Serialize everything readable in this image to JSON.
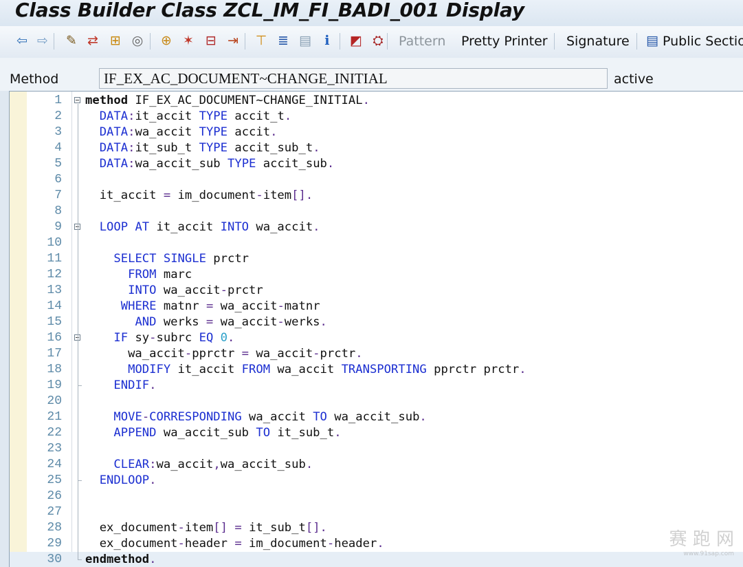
{
  "window": {
    "title": "Class Builder Class ZCL_IM_FI_BADI_001 Display"
  },
  "toolbar": {
    "icons": [
      {
        "name": "back-icon",
        "glyph": "⇦",
        "color": "#2f6fb6"
      },
      {
        "name": "forward-icon",
        "glyph": "⇨",
        "color": "#7aa1c8"
      },
      {
        "name": "display-change-icon",
        "glyph": "✎",
        "color": "#7a5a1e"
      },
      {
        "name": "active-inactive-icon",
        "glyph": "⇄",
        "color": "#c0392b"
      },
      {
        "name": "check-icon",
        "glyph": "⊞",
        "color": "#c98a12"
      },
      {
        "name": "activate-icon",
        "glyph": "◎",
        "color": "#666666"
      },
      {
        "name": "object-list-icon",
        "glyph": "⊕",
        "color": "#c88b1c"
      },
      {
        "name": "wand-icon",
        "glyph": "✶",
        "color": "#c0392b"
      },
      {
        "name": "where-used-icon",
        "glyph": "⊟",
        "color": "#b02a2a"
      },
      {
        "name": "navigation-icon",
        "glyph": "⇥",
        "color": "#b9461f"
      },
      {
        "name": "hierarchy-icon",
        "glyph": "⊤",
        "color": "#d08a12"
      },
      {
        "name": "stack-icon",
        "glyph": "≣",
        "color": "#2456a8"
      },
      {
        "name": "table-icon",
        "glyph": "▤",
        "color": "#8aa0b4"
      },
      {
        "name": "info-icon",
        "glyph": "ℹ",
        "color": "#1f5fbf"
      },
      {
        "name": "module-icon",
        "glyph": "◩",
        "color": "#b52525"
      },
      {
        "name": "debug-icon",
        "glyph": "⛭",
        "color": "#a52121"
      }
    ],
    "pattern_label": "Pattern",
    "pretty_printer_label": "Pretty Printer",
    "signature_label": "Signature",
    "public_section_label": "Public Section"
  },
  "method_bar": {
    "label": "Method",
    "value": "IF_EX_AC_DOCUMENT~CHANGE_INITIAL",
    "status": "active"
  },
  "editor": {
    "lines": [
      {
        "n": "1",
        "html": "<span class=\"kwb\">method</span> IF_EX_AC_DOCUMENT~CHANGE_INITIAL<span class=\"pn\">.</span>"
      },
      {
        "n": "2",
        "html": "  <span class=\"kw\">DATA</span><span class=\"pn\">:</span>it_accit <span class=\"kw\">TYPE</span> accit_t<span class=\"pn\">.</span>"
      },
      {
        "n": "3",
        "html": "  <span class=\"kw\">DATA</span><span class=\"pn\">:</span>wa_accit <span class=\"kw\">TYPE</span> accit<span class=\"pn\">.</span>"
      },
      {
        "n": "4",
        "html": "  <span class=\"kw\">DATA</span><span class=\"pn\">:</span>it_sub_t <span class=\"kw\">TYPE</span> accit_sub_t<span class=\"pn\">.</span>"
      },
      {
        "n": "5",
        "html": "  <span class=\"kw\">DATA</span><span class=\"pn\">:</span>wa_accit_sub <span class=\"kw\">TYPE</span> accit_sub<span class=\"pn\">.</span>"
      },
      {
        "n": "6",
        "html": ""
      },
      {
        "n": "7",
        "html": "  it_accit <span class=\"pn\">=</span> im_document<span class=\"pn\">-</span>item<span class=\"pn\">[].</span>"
      },
      {
        "n": "8",
        "html": ""
      },
      {
        "n": "9",
        "html": "  <span class=\"kw\">LOOP AT</span> it_accit <span class=\"kw\">INTO</span> wa_accit<span class=\"pn\">.</span>"
      },
      {
        "n": "10",
        "html": ""
      },
      {
        "n": "11",
        "html": "    <span class=\"kw\">SELECT SINGLE</span> prctr"
      },
      {
        "n": "12",
        "html": "      <span class=\"kw\">FROM</span> marc"
      },
      {
        "n": "13",
        "html": "      <span class=\"kw\">INTO</span> wa_accit<span class=\"pn\">-</span>prctr"
      },
      {
        "n": "14",
        "html": "     <span class=\"kw\">WHERE</span> matnr <span class=\"pn\">=</span> wa_accit<span class=\"pn\">-</span>matnr"
      },
      {
        "n": "15",
        "html": "       <span class=\"kw\">AND</span> werks <span class=\"pn\">=</span> wa_accit<span class=\"pn\">-</span>werks<span class=\"pn\">.</span>"
      },
      {
        "n": "16",
        "html": "    <span class=\"kw\">IF</span> sy<span class=\"pn\">-</span>subrc <span class=\"kw\">EQ</span> <span class=\"nm\">0</span><span class=\"pn\">.</span>"
      },
      {
        "n": "17",
        "html": "      wa_accit<span class=\"pn\">-</span>pprctr <span class=\"pn\">=</span> wa_accit<span class=\"pn\">-</span>prctr<span class=\"pn\">.</span>"
      },
      {
        "n": "18",
        "html": "      <span class=\"kw\">MODIFY</span> it_accit <span class=\"kw\">FROM</span> wa_accit <span class=\"kw\">TRANSPORTING</span> pprctr prctr<span class=\"pn\">.</span>"
      },
      {
        "n": "19",
        "html": "    <span class=\"kw\">ENDIF</span><span class=\"pn\">.</span>"
      },
      {
        "n": "20",
        "html": ""
      },
      {
        "n": "21",
        "html": "    <span class=\"kw\">MOVE</span><span class=\"pn\">-</span><span class=\"kw\">CORRESPONDING</span> wa_accit <span class=\"kw\">TO</span> wa_accit_sub<span class=\"pn\">.</span>"
      },
      {
        "n": "22",
        "html": "    <span class=\"kw\">APPEND</span> wa_accit_sub <span class=\"kw\">TO</span> it_sub_t<span class=\"pn\">.</span>"
      },
      {
        "n": "23",
        "html": ""
      },
      {
        "n": "24",
        "html": "    <span class=\"kw\">CLEAR</span><span class=\"pn\">:</span>wa_accit<span class=\"pn\">,</span>wa_accit_sub<span class=\"pn\">.</span>"
      },
      {
        "n": "25",
        "html": "  <span class=\"kw\">ENDLOOP</span><span class=\"pn\">.</span>"
      },
      {
        "n": "26",
        "html": ""
      },
      {
        "n": "27",
        "html": ""
      },
      {
        "n": "28",
        "html": "  ex_document<span class=\"pn\">-</span>item<span class=\"pn\">[]</span> <span class=\"pn\">=</span> it_sub_t<span class=\"pn\">[].</span>"
      },
      {
        "n": "29",
        "html": "  ex_document<span class=\"pn\">-</span>header <span class=\"pn\">=</span> im_document<span class=\"pn\">-</span>header<span class=\"pn\">.</span>"
      },
      {
        "n": "30",
        "html": "<span class=\"kwb\">endmethod</span><span class=\"pn\">.</span>"
      }
    ],
    "fold_lines": [
      "1",
      "9",
      "16"
    ],
    "current_line": "30"
  },
  "watermark": {
    "text": "赛  跑  网",
    "sub": "www.91sap.com"
  }
}
